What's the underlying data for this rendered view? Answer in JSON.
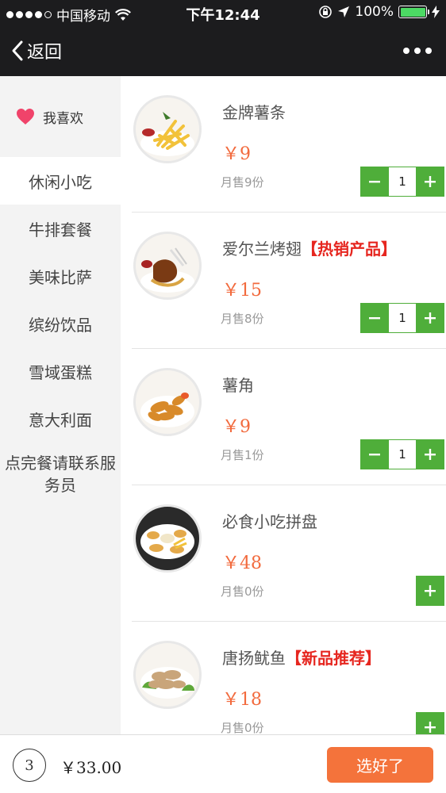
{
  "status_bar": {
    "carrier": "中国移动",
    "time": "下午12:44",
    "battery": "100%",
    "battery_color": "#4cd964"
  },
  "nav": {
    "back_label": "返回",
    "more_icon": "more-dots-icon"
  },
  "sidebar": {
    "favorite_label": "我喜欢",
    "categories": [
      "休闲小吃",
      "牛排套餐",
      "美味比萨",
      "缤纷饮品",
      "雪域蛋糕",
      "意大利面"
    ],
    "note": "点完餐请联系服务员",
    "active_index": 0
  },
  "products": [
    {
      "name": "金牌薯条",
      "tag": "",
      "price": "￥9",
      "sold": "月售9份",
      "qty": "1"
    },
    {
      "name": "爱尔兰烤翅",
      "tag": "【热销产品】",
      "price": "￥15",
      "sold": "月售8份",
      "qty": "1"
    },
    {
      "name": "薯角",
      "tag": "",
      "price": "￥9",
      "sold": "月售1份",
      "qty": "1"
    },
    {
      "name": "必食小吃拼盘",
      "tag": "",
      "price": "￥48",
      "sold": "月售0份",
      "qty": ""
    },
    {
      "name": "唐扬鱿鱼",
      "tag": "【新品推荐】",
      "price": "￥18",
      "sold": "月售0份",
      "qty": ""
    }
  ],
  "cart": {
    "count": "3",
    "total": "￥33.00",
    "checkout_label": "选好了"
  },
  "colors": {
    "accent": "#4fae3a",
    "price": "#f26a3d",
    "tag": "#e6261f",
    "checkout": "#f4733b"
  }
}
